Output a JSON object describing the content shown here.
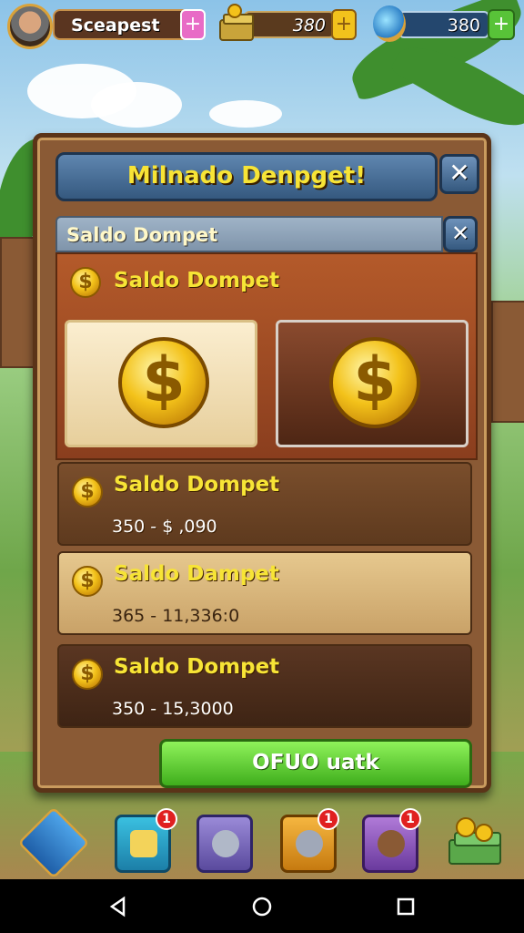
{
  "hud": {
    "player_name": "Sceapest",
    "currency1_value": "380",
    "currency2_value": "380",
    "plus_symbol": "+"
  },
  "dialog": {
    "title": "Milnado Denpget!",
    "close_symbol": "✕",
    "subheader": "Saldo Dompet",
    "inner_label": "Saldo Dompet",
    "coin_symbol": "$",
    "rows": [
      {
        "label": "Saldo Dompet",
        "value": "350 - $ ,090"
      },
      {
        "label": "Saldo Dampet",
        "value": "365 - 11,336:0"
      },
      {
        "label": "Saldo Dompet",
        "value": "350 - 15,3000"
      }
    ],
    "confirm_label": "OFUO uatk"
  },
  "dock": {
    "badges": [
      "1",
      "1",
      "1"
    ]
  },
  "navbar": {
    "back_icon": "back-icon",
    "home_icon": "home-icon",
    "recents_icon": "recents-icon"
  },
  "colors": {
    "title_text": "#f7e436",
    "panel": "#8a5a35",
    "confirm_green": "#3fae1c"
  }
}
